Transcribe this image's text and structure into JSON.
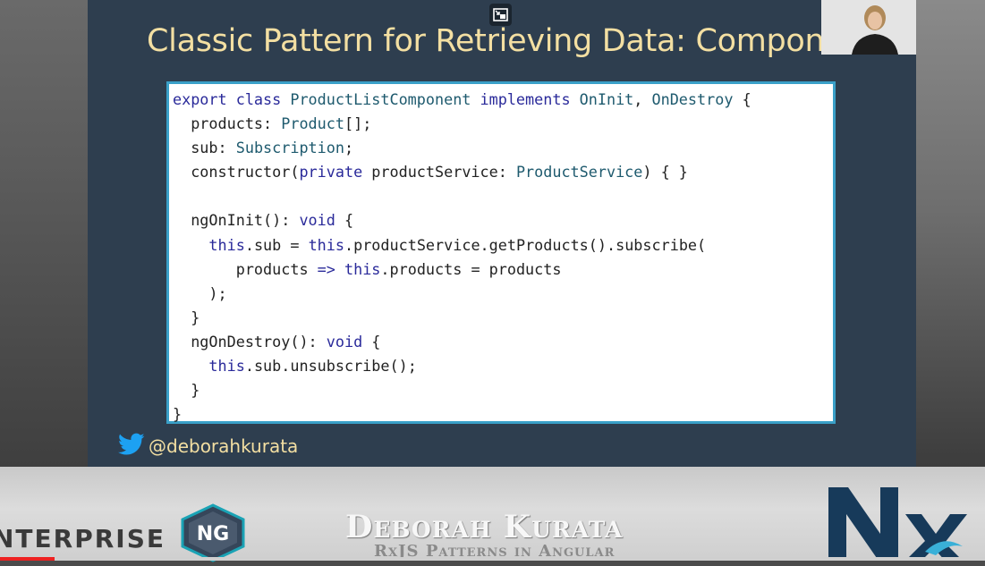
{
  "slide": {
    "title": "Classic Pattern for Retrieving Data: Component",
    "code_lines": [
      [
        {
          "t": "export class ",
          "c": "kw"
        },
        {
          "t": "ProductListComponent ",
          "c": "ty"
        },
        {
          "t": "implements ",
          "c": "kw"
        },
        {
          "t": "OnInit",
          "c": "ty"
        },
        {
          "t": ", "
        },
        {
          "t": "OnDestroy",
          "c": "ty"
        },
        {
          "t": " {"
        }
      ],
      [
        {
          "t": "  products: "
        },
        {
          "t": "Product",
          "c": "ty"
        },
        {
          "t": "[];"
        }
      ],
      [
        {
          "t": "  sub: "
        },
        {
          "t": "Subscription",
          "c": "ty"
        },
        {
          "t": ";"
        }
      ],
      [
        {
          "t": "  constructor("
        },
        {
          "t": "private ",
          "c": "kw"
        },
        {
          "t": "productService: "
        },
        {
          "t": "ProductService",
          "c": "ty"
        },
        {
          "t": ") { }"
        }
      ],
      [
        {
          "t": ""
        }
      ],
      [
        {
          "t": "  ngOnInit(): "
        },
        {
          "t": "void",
          "c": "kw"
        },
        {
          "t": " {"
        }
      ],
      [
        {
          "t": "    "
        },
        {
          "t": "this",
          "c": "kw"
        },
        {
          "t": ".sub = "
        },
        {
          "t": "this",
          "c": "kw"
        },
        {
          "t": ".productService.getProducts().subscribe("
        }
      ],
      [
        {
          "t": "       products "
        },
        {
          "t": "=>",
          "c": "kw"
        },
        {
          "t": " "
        },
        {
          "t": "this",
          "c": "kw"
        },
        {
          "t": ".products = products"
        }
      ],
      [
        {
          "t": "    );"
        }
      ],
      [
        {
          "t": "  }"
        }
      ],
      [
        {
          "t": "  ngOnDestroy(): "
        },
        {
          "t": "void",
          "c": "kw"
        },
        {
          "t": " {"
        }
      ],
      [
        {
          "t": "    "
        },
        {
          "t": "this",
          "c": "kw"
        },
        {
          "t": ".sub.unsubscribe();"
        }
      ],
      [
        {
          "t": "  }"
        }
      ],
      [
        {
          "t": "}"
        }
      ]
    ],
    "twitter_icon": "twitter-bird-icon",
    "twitter_handle": "@deborahkurata"
  },
  "player": {
    "exit_icon": "exit-miniplayer-icon",
    "progress": 0.055
  },
  "banner": {
    "enterprise_text": "NTERPRISE",
    "ng_badge_text": "NG",
    "speaker_name": "Deborah Kurata",
    "talk_title": "RxJS Patterns in Angular"
  },
  "colors": {
    "slide_bg": "#2e3e4f",
    "title": "#f3dfa2",
    "code_border": "#3aa0c8",
    "keyword": "#2a2a9a",
    "type": "#1e5a6e",
    "progress": "#ee2222"
  }
}
